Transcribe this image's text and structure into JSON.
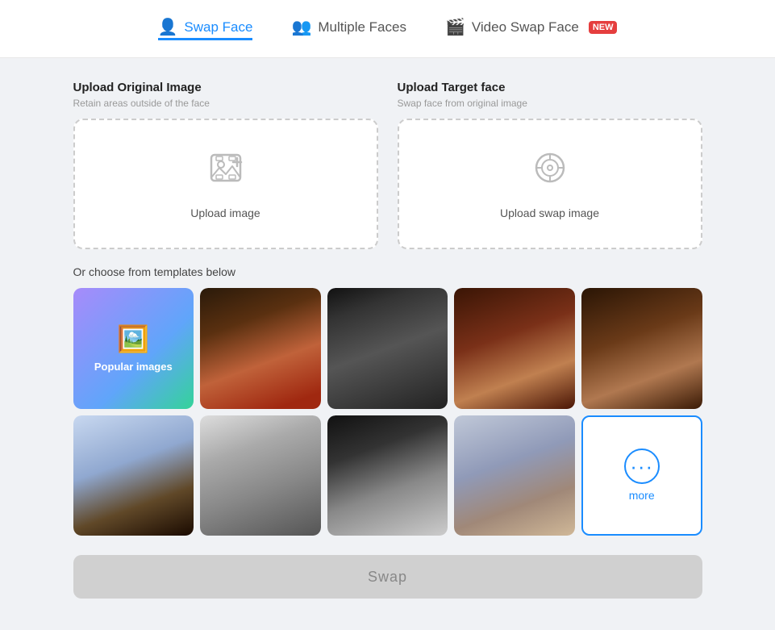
{
  "tabs": [
    {
      "id": "swap-face",
      "label": "Swap Face",
      "icon": "👤",
      "active": true,
      "badge": null
    },
    {
      "id": "multiple-faces",
      "label": "Multiple Faces",
      "icon": "👥",
      "active": false,
      "badge": null
    },
    {
      "id": "video-swap-face",
      "label": "Video Swap Face",
      "icon": "🎬",
      "active": false,
      "badge": "NEW"
    }
  ],
  "upload": {
    "original": {
      "title": "Upload Original Image",
      "subtitle": "Retain areas outside of the face",
      "label": "Upload image"
    },
    "target": {
      "title": "Upload Target face",
      "subtitle": "Swap face from original image",
      "label": "Upload swap image"
    }
  },
  "templates": {
    "section_label": "Or choose from templates below",
    "popular_label": "Popular images",
    "more_label": "more"
  },
  "swap_button": "Swap"
}
